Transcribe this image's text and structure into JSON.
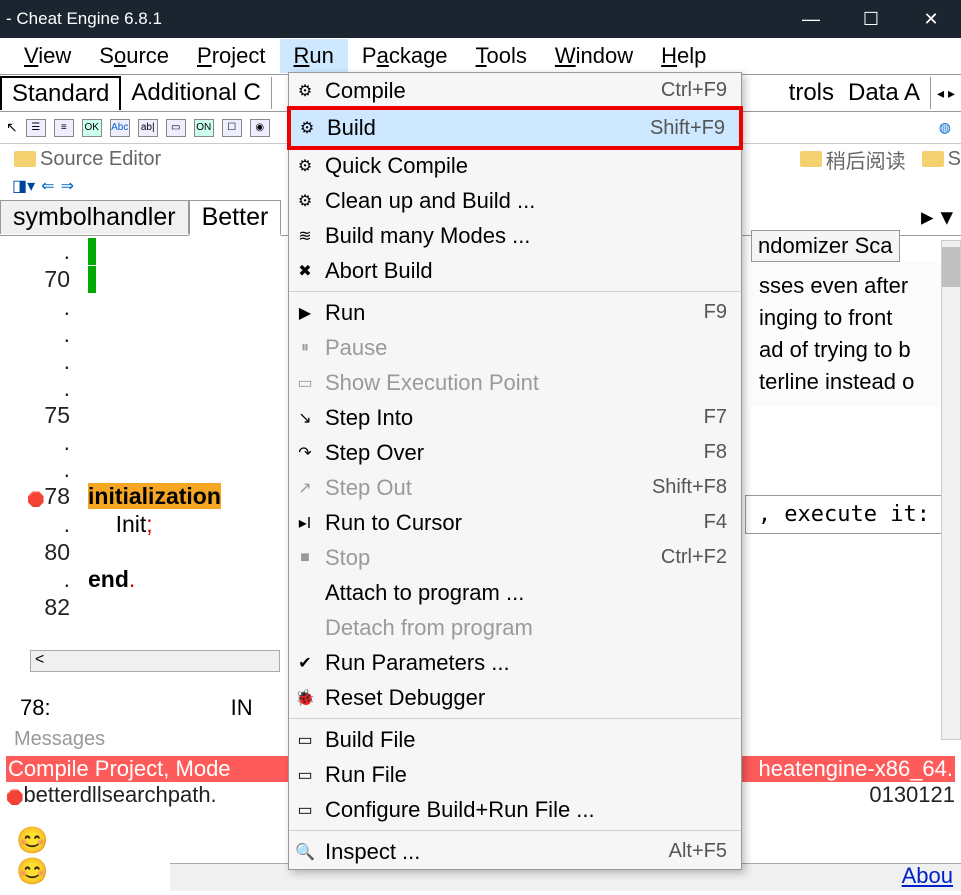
{
  "title": " - Cheat Engine 6.8.1",
  "menubar": [
    "View",
    "Source",
    "Project",
    "Run",
    "Package",
    "Tools",
    "Window",
    "Help"
  ],
  "tabs": [
    "Standard",
    "Additional  C",
    "trols",
    "Data A"
  ],
  "bookmarks": {
    "src": "Source Editor",
    "b1": "稍后阅读",
    "b2": "S"
  },
  "filetabs": [
    "symbolhandler",
    "Better"
  ],
  "righttab": "ndomizer Sca",
  "righttext": [
    "sses even after",
    "inging to front",
    "ad of trying to b",
    "terline instead o"
  ],
  "code_exec": ", execute it:",
  "code": {
    "ln70": "70",
    "ln75": "75",
    "ln78": "78",
    "ln80": "80",
    "ln82": "82",
    "init": "initialization",
    "init2": "Init",
    "semi": ";",
    "end": "end",
    "dot": "."
  },
  "status": {
    "line": "78:",
    "col": "IN"
  },
  "messages": "Messages",
  "err1_a": "Compile Project, Mode",
  "err1_b": "heatengine-x86_64.",
  "err2_a": "betterdllsearchpath.",
  "err2_b": "0130121",
  "about": "Abou",
  "dropdown": [
    {
      "lbl": "Compile",
      "accel": "Ctrl+F9",
      "icn": "⚙"
    },
    {
      "lbl": "Build",
      "accel": "Shift+F9",
      "icn": "⚙",
      "hl": true
    },
    {
      "lbl": "Quick Compile",
      "icn": "⚙"
    },
    {
      "lbl": "Clean up and Build ...",
      "icn": "⚙"
    },
    {
      "lbl": "Build many Modes ...",
      "icn": "≋"
    },
    {
      "lbl": "Abort Build",
      "icn": "✖"
    },
    {
      "sep": true
    },
    {
      "lbl": "Run",
      "accel": "F9",
      "icn": "▶"
    },
    {
      "lbl": "Pause",
      "icn": "⏸",
      "dis": true
    },
    {
      "lbl": "Show Execution Point",
      "icn": "▭",
      "dis": true
    },
    {
      "lbl": "Step Into",
      "accel": "F7",
      "icn": "↘"
    },
    {
      "lbl": "Step Over",
      "accel": "F8",
      "icn": "↷"
    },
    {
      "lbl": "Step Out",
      "accel": "Shift+F8",
      "icn": "↗",
      "dis": true
    },
    {
      "lbl": "Run to Cursor",
      "accel": "F4",
      "icn": "▸I"
    },
    {
      "lbl": "Stop",
      "accel": "Ctrl+F2",
      "icn": "■",
      "dis": true
    },
    {
      "lbl": "Attach to program ..."
    },
    {
      "lbl": "Detach from program",
      "dis": true
    },
    {
      "lbl": "Run Parameters ...",
      "icn": "✔"
    },
    {
      "lbl": "Reset Debugger",
      "icn": "🐞"
    },
    {
      "sep": true
    },
    {
      "lbl": "Build File",
      "icn": "▭"
    },
    {
      "lbl": "Run File",
      "icn": "▭"
    },
    {
      "lbl": "Configure Build+Run File ...",
      "icn": "▭"
    },
    {
      "sep": true
    },
    {
      "lbl": "Inspect ...",
      "accel": "Alt+F5",
      "icn": "🔍"
    }
  ]
}
